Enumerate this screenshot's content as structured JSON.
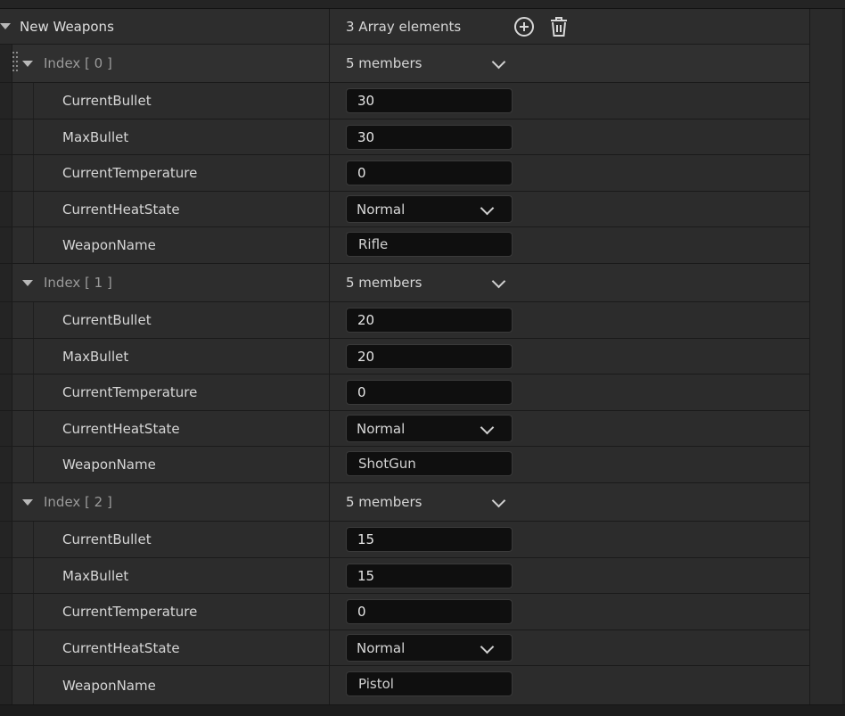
{
  "array": {
    "name": "New Weapons",
    "count_label": "3 Array elements"
  },
  "elements": [
    {
      "index_label": "Index [ 0 ]",
      "members_label": "5 members",
      "props": {
        "current_bullet": {
          "label": "CurrentBullet",
          "value": "30"
        },
        "max_bullet": {
          "label": "MaxBullet",
          "value": "30"
        },
        "current_temperature": {
          "label": "CurrentTemperature",
          "value": "0"
        },
        "current_heat_state": {
          "label": "CurrentHeatState",
          "value": "Normal"
        },
        "weapon_name": {
          "label": "WeaponName",
          "value": "Rifle"
        }
      }
    },
    {
      "index_label": "Index [ 1 ]",
      "members_label": "5 members",
      "props": {
        "current_bullet": {
          "label": "CurrentBullet",
          "value": "20"
        },
        "max_bullet": {
          "label": "MaxBullet",
          "value": "20"
        },
        "current_temperature": {
          "label": "CurrentTemperature",
          "value": "0"
        },
        "current_heat_state": {
          "label": "CurrentHeatState",
          "value": "Normal"
        },
        "weapon_name": {
          "label": "WeaponName",
          "value": "ShotGun"
        }
      }
    },
    {
      "index_label": "Index [ 2 ]",
      "members_label": "5 members",
      "props": {
        "current_bullet": {
          "label": "CurrentBullet",
          "value": "15"
        },
        "max_bullet": {
          "label": "MaxBullet",
          "value": "15"
        },
        "current_temperature": {
          "label": "CurrentTemperature",
          "value": "0"
        },
        "current_heat_state": {
          "label": "CurrentHeatState",
          "value": "Normal"
        },
        "weapon_name": {
          "label": "WeaponName",
          "value": "Pistol"
        }
      }
    }
  ],
  "icons": {
    "add": "plus-circle-icon",
    "delete": "trash-icon",
    "expand": "chevron-down-icon",
    "collapse_arrow": "triangle-down-icon",
    "drag": "drag-grip-icon"
  }
}
